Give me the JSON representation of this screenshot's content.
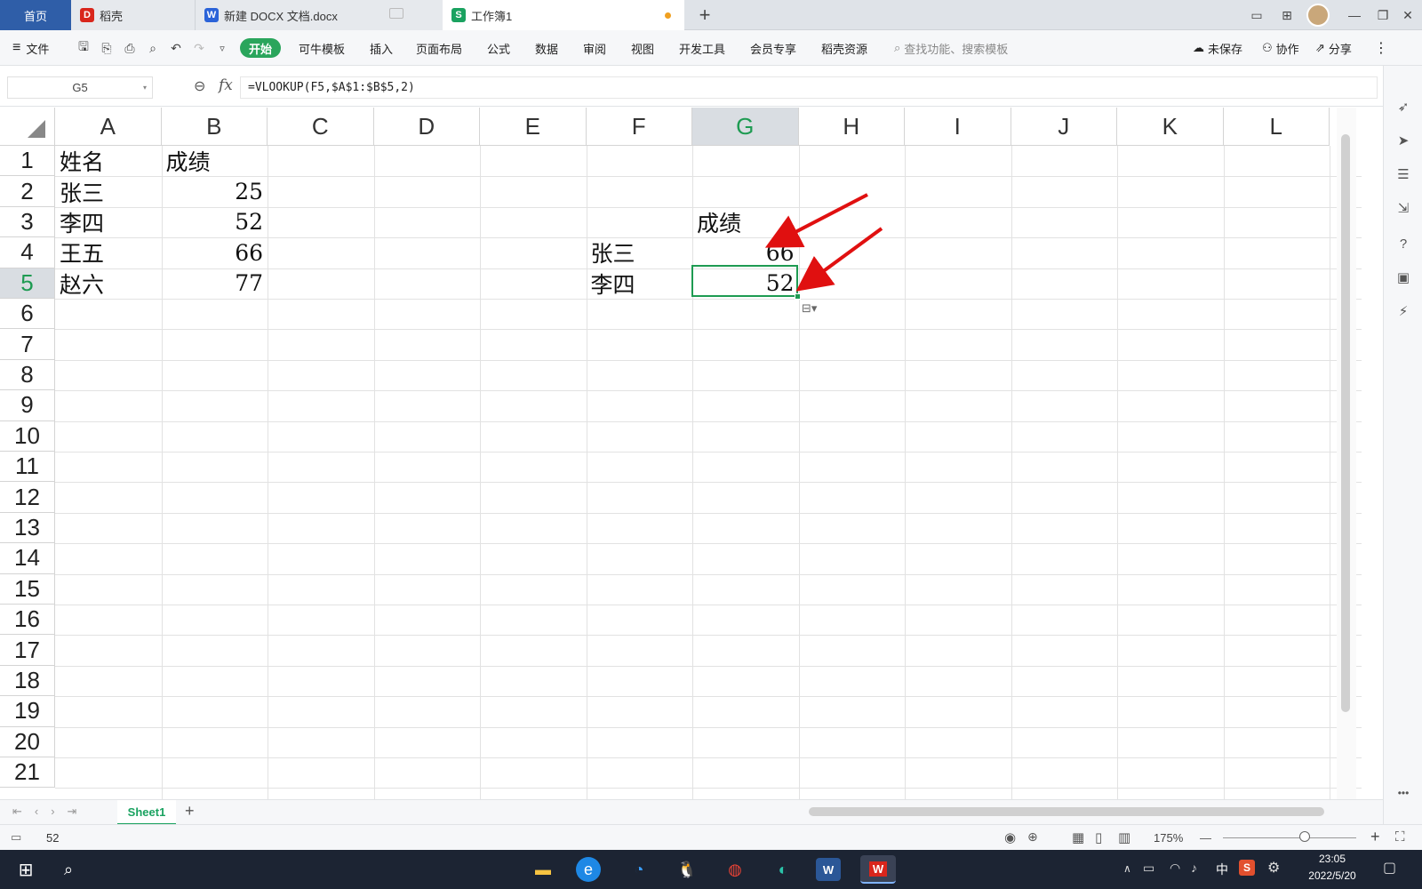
{
  "tabs": {
    "home": "首页",
    "daoke": "稻壳",
    "docx": "新建 DOCX 文档.docx",
    "workbook": "工作簿1",
    "new_tab": "+"
  },
  "menu": {
    "file": "文件",
    "items": [
      "开始",
      "可牛模板",
      "插入",
      "页面布局",
      "公式",
      "数据",
      "审阅",
      "视图",
      "开发工具",
      "会员专享",
      "稻壳资源"
    ],
    "search_placeholder": "查找功能、搜索模板",
    "unsaved": "未保存",
    "collab": "协作",
    "share": "分享"
  },
  "formula_bar": {
    "name_box": "G5",
    "fx": "fx",
    "formula": "=VLOOKUP(F5,$A$1:$B$5,2)"
  },
  "grid": {
    "columns": [
      "A",
      "B",
      "C",
      "D",
      "E",
      "F",
      "G",
      "H",
      "I",
      "J",
      "K",
      "L"
    ],
    "rows": [
      "1",
      "2",
      "3",
      "4",
      "5",
      "6",
      "7",
      "8",
      "9",
      "10",
      "11",
      "12",
      "13",
      "14",
      "15",
      "16",
      "17",
      "18",
      "19",
      "20",
      "21"
    ],
    "selected_cell": "G5"
  },
  "cells": {
    "A1": "姓名",
    "B1": "成绩",
    "A2": "张三",
    "B2": "25",
    "A3": "李四",
    "B3": "52",
    "A4": "王五",
    "B4": "66",
    "A5": "赵六",
    "B5": "77",
    "G3": "成绩",
    "F4": "张三",
    "G4": "66",
    "F5": "李四",
    "G5": "52"
  },
  "sheets": [
    "Sheet1"
  ],
  "status": {
    "value": "52",
    "zoom": "175%"
  },
  "taskbar": {
    "time": "23:05",
    "date": "2022/5/20",
    "ime": "中"
  },
  "colors": {
    "accent_green": "#2aa55c",
    "home_tab": "#2f5ea8",
    "arrow_red": "#e01010"
  }
}
